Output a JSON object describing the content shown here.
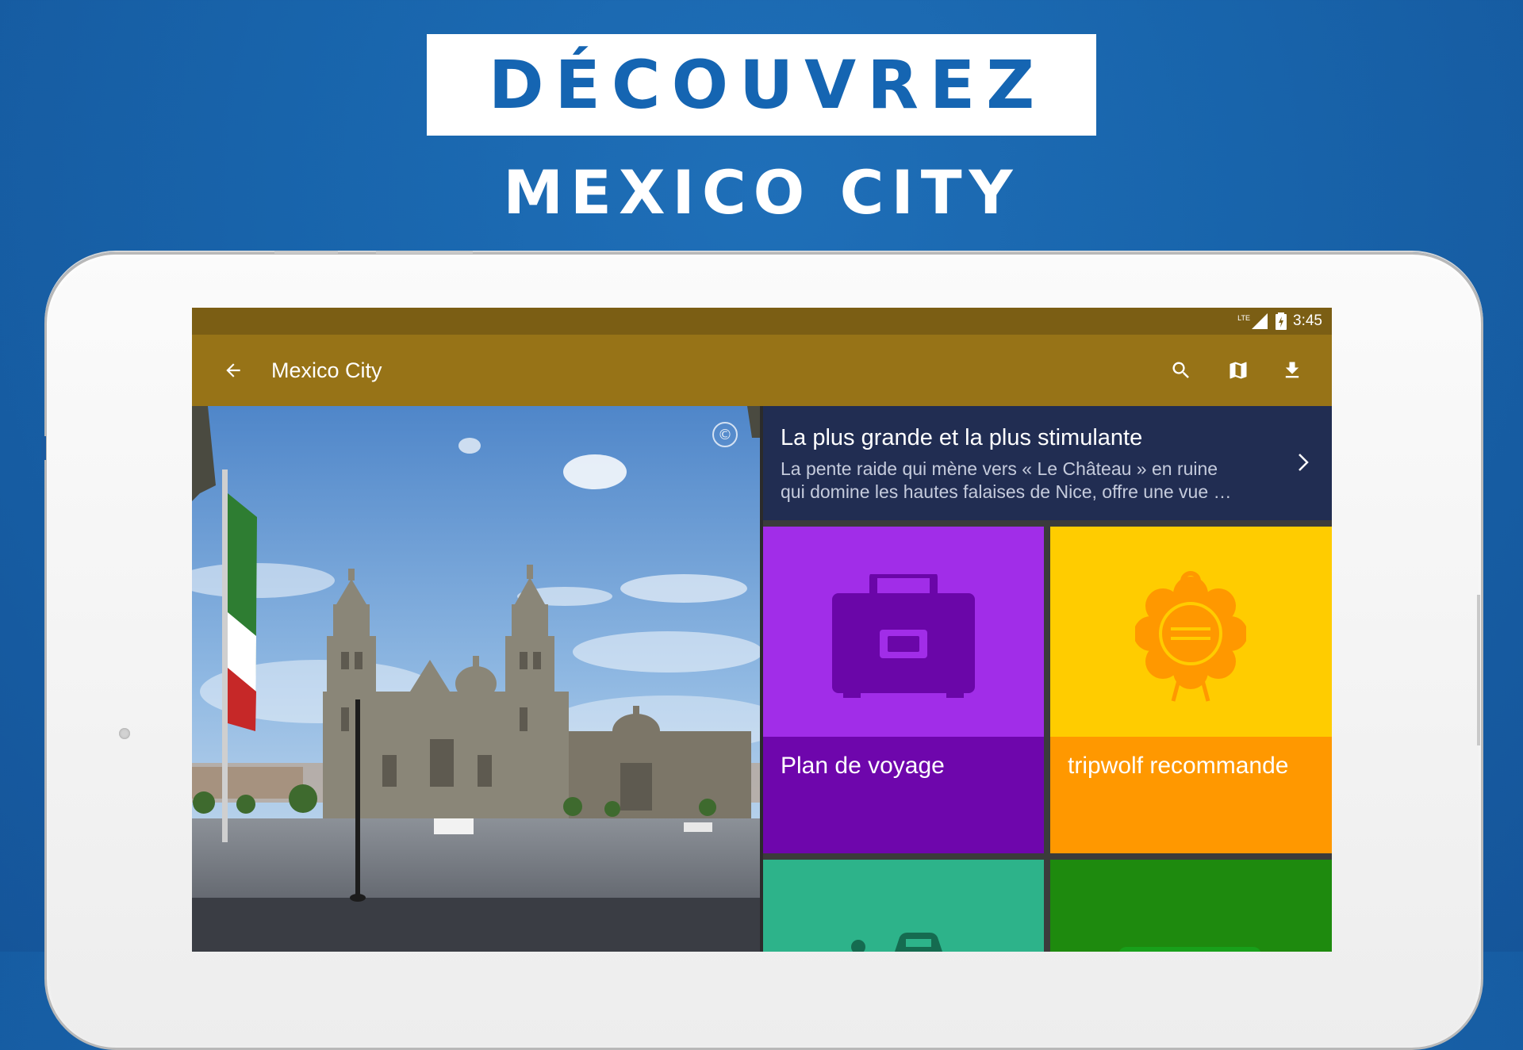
{
  "promo": {
    "headline": "DÉCOUVREZ",
    "subheadline": "MEXICO CITY"
  },
  "status_bar": {
    "network": "LTE",
    "time": "3:45"
  },
  "app_bar": {
    "title": "Mexico City",
    "actions": [
      "back-arrow-icon",
      "search-icon",
      "map-icon",
      "download-icon"
    ]
  },
  "featured": {
    "title": "La plus grande et la plus stimulante",
    "description_line1": "La pente raide qui mène vers « Le Château » en ruine",
    "description_line2": "qui domine les hautes falaises de Nice, offre une vue …"
  },
  "tiles": [
    {
      "label": "Plan de voyage",
      "icon": "briefcase-icon",
      "color": "#a12de8",
      "label_color": "#6e06ac",
      "icon_color": "#6a06a8"
    },
    {
      "label": "tripwolf recommande",
      "icon": "seal-icon",
      "color": "#ffcc00",
      "label_color": "#ff9800",
      "icon_color": "#ff9800"
    },
    {
      "label": "",
      "icon": "car-icon",
      "color": "#2db38a"
    },
    {
      "label": "",
      "icon": "ticket-icon",
      "color": "#1e8a0e"
    }
  ],
  "colors": {
    "background": "#1864ab",
    "status_bar": "#7b5e14",
    "app_bar": "#977317",
    "featured_bg": "#212d52"
  }
}
